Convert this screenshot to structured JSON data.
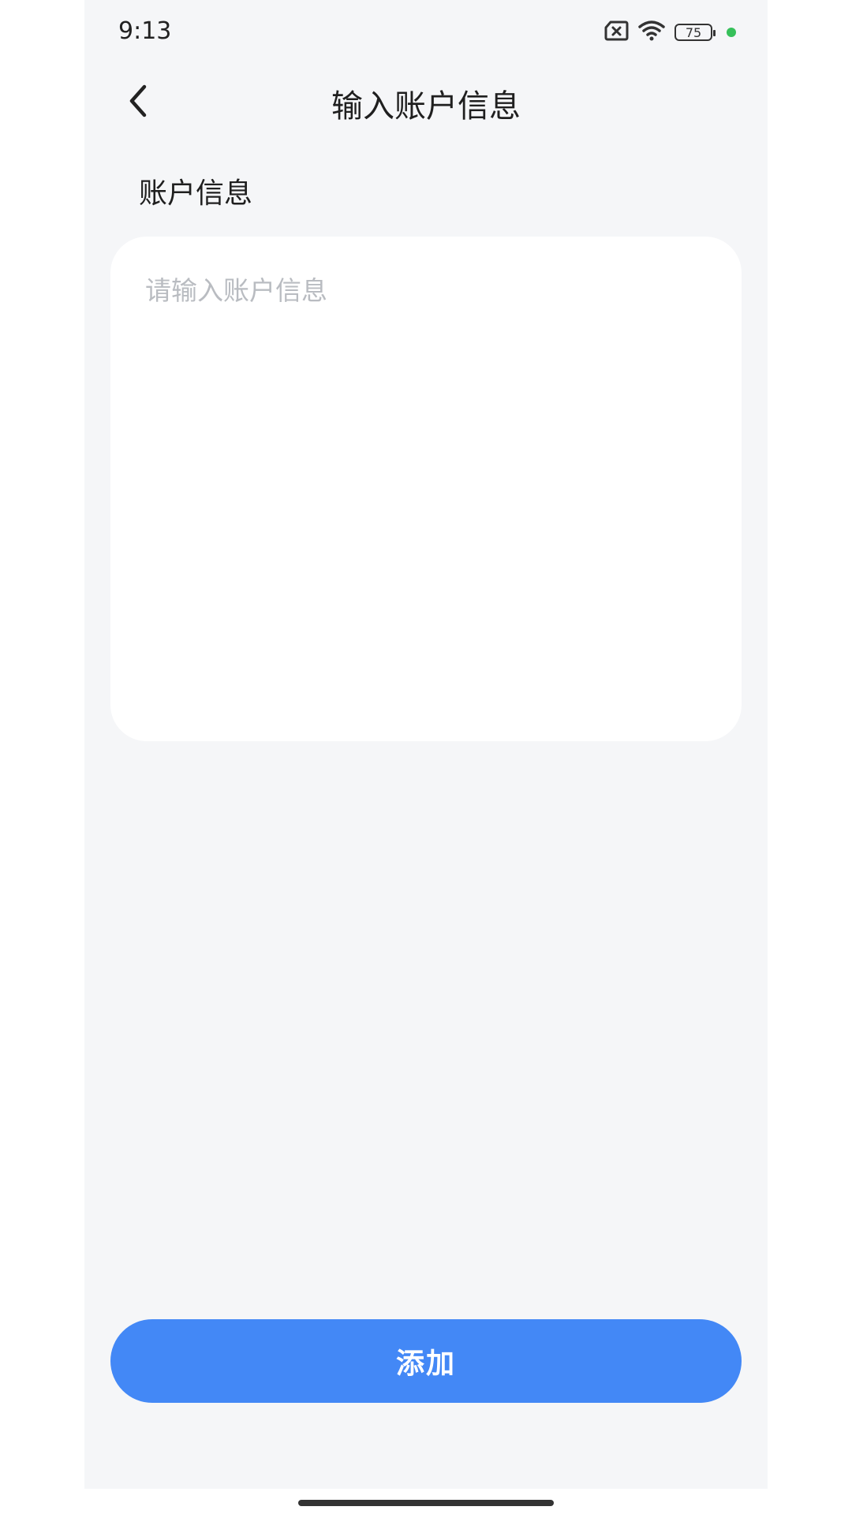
{
  "status_bar": {
    "time": "9:13",
    "battery": "75",
    "icons": [
      "sim-x-icon",
      "wifi-icon",
      "battery-icon"
    ]
  },
  "header": {
    "title": "输入账户信息",
    "back_icon": "chevron-left-icon"
  },
  "form": {
    "section_label": "账户信息",
    "input_value": "",
    "input_placeholder": "请输入账户信息"
  },
  "actions": {
    "add_label": "添加"
  },
  "colors": {
    "background": "#f5f6f8",
    "primary": "#4388f6",
    "placeholder": "#b9bcc1",
    "status_dot": "#36c05a"
  }
}
